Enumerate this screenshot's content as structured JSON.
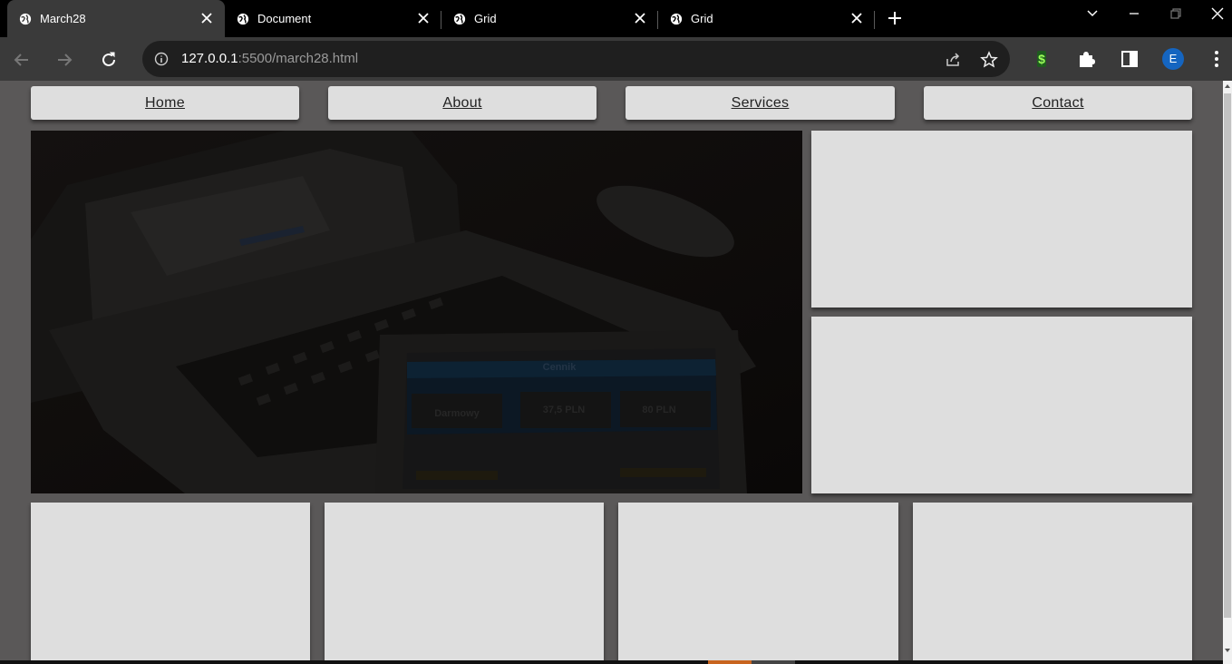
{
  "browser": {
    "tabs": [
      {
        "title": "March28",
        "active": true
      },
      {
        "title": "Document",
        "active": false
      },
      {
        "title": "Grid",
        "active": false
      },
      {
        "title": "Grid",
        "active": false
      }
    ],
    "url": {
      "host": "127.0.0.1",
      "rest": ":5500/march28.html"
    },
    "profile_initial": "E"
  },
  "page": {
    "nav": {
      "home": "Home",
      "about": "About",
      "services": "Services",
      "contact": "Contact"
    },
    "hero_image": {
      "screen_heading": "Cennik",
      "prices": [
        "Darmowy",
        "37,5 PLN",
        "80 PLN"
      ]
    }
  },
  "colors": {
    "page_background": "#5a5858",
    "card": "#dedede",
    "browser_chrome": "#3a3a3a",
    "profile_avatar": "#1565c0"
  }
}
